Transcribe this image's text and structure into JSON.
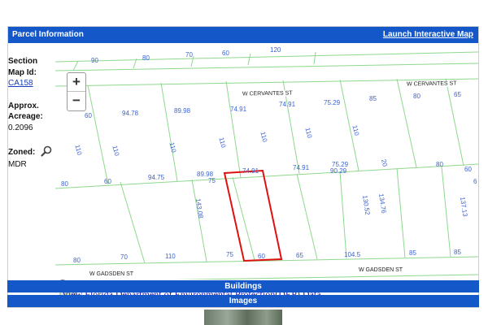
{
  "header": {
    "title": "Parcel Information",
    "launch_link": "Launch Interactive Map"
  },
  "parcel": {
    "section_label": "Section",
    "map_id_label": "Map Id:",
    "map_id_value": "CA158",
    "acreage_label_1": "Approx.",
    "acreage_label_2": "Acreage:",
    "acreage_value": "0.2096",
    "zoned_label": "Zoned:",
    "zoned_value": "MDR"
  },
  "map": {
    "zoom_in": "+",
    "zoom_out": "−",
    "streets": {
      "cervantes_1": "W CERVANTES ST",
      "cervantes_2": "W CERVANTES ST",
      "gadsden_1": "W GADSDEN ST",
      "gadsden_2": "W GADSDEN ST"
    },
    "dims": {
      "t1": "90",
      "t2": "80",
      "t3": "70",
      "t4": "60",
      "t5": "120",
      "r1": "60",
      "r2": "94.78",
      "r3": "89.98",
      "r4": "74.91",
      "r5": "74.91",
      "r6": "75.29",
      "r7": "85",
      "r8": "80",
      "r9": "65",
      "v1": "110",
      "v2": "110",
      "v3": "110",
      "v4": "110",
      "v5": "110",
      "v6": "110",
      "v7": "110",
      "m1": "80",
      "m2": "60",
      "m3": "94.75",
      "m4": "89.98",
      "m5": "75",
      "m6": "74.91",
      "m7": "74.91",
      "m8": "75.29",
      "m9": "90.29",
      "m10": "80",
      "m11": "20",
      "m12": "60",
      "m13": "6",
      "s1": "143.08",
      "s2": "130.52",
      "s3": "134.76",
      "s4": "137.13",
      "b1": "80",
      "b2": "70",
      "b3": "110",
      "b4": "75",
      "b5": "60",
      "b6": "65",
      "b7": "104.5",
      "b8": "85",
      "b9": "85"
    },
    "colors": {
      "parcel_line": "#8fd88f",
      "dim_text": "#3b63d4",
      "selected_parcel": "#e01010",
      "street_label_bg": "#ffffff"
    }
  },
  "dep_link": "View Florida Department of Environmental Protection(DEP) Data",
  "sections": {
    "buildings": "Buildings",
    "images": "Images"
  },
  "colors": {
    "header_bg": "#1357c9",
    "link": "#1a3cc0"
  }
}
